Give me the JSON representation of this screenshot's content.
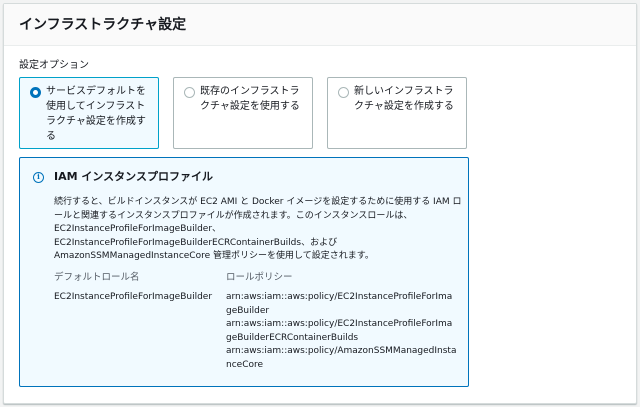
{
  "panel": {
    "title": "インフラストラクチャ設定"
  },
  "options": {
    "label": "設定オプション",
    "tiles": [
      {
        "label": "サービスデフォルトを使用してインフラストラクチャ設定を作成する",
        "selected": true
      },
      {
        "label": "既存のインフラストラクチャ設定を使用する",
        "selected": false
      },
      {
        "label": "新しいインフラストラクチャ設定を作成する",
        "selected": false
      }
    ]
  },
  "info": {
    "title": "IAM インスタンスプロファイル",
    "description": "続行すると、ビルドインスタンスが EC2 AMI と Docker イメージを設定するために使用する IAM ロールと関連するインスタンスプロファイルが作成されます。このインスタンスロールは、EC2InstanceProfileForImageBuilder、EC2InstanceProfileForImageBuilderECRContainerBuilds、および AmazonSSMManagedInstanceCore 管理ポリシーを使用して設定されます。",
    "default_role_header": "デフォルトロール名",
    "default_role_value": "EC2InstanceProfileForImageBuilder",
    "policy_header": "ロールポリシー",
    "policies": [
      "arn:aws:iam::aws:policy/EC2InstanceProfileForImageBuilder",
      "arn:aws:iam::aws:policy/EC2InstanceProfileForImageBuilderECRContainerBuilds",
      "arn:aws:iam::aws:policy/AmazonSSMManagedInstanceCore"
    ]
  },
  "colors": {
    "accent": "#0073bb",
    "selected_tile_bg": "#f1faff",
    "info_bg": "#f1faff",
    "header_bg": "#fafafa"
  },
  "icons": {
    "info": "info-circle-icon",
    "radio_selected": "radio-selected-icon",
    "radio_unselected": "radio-unselected-icon"
  }
}
